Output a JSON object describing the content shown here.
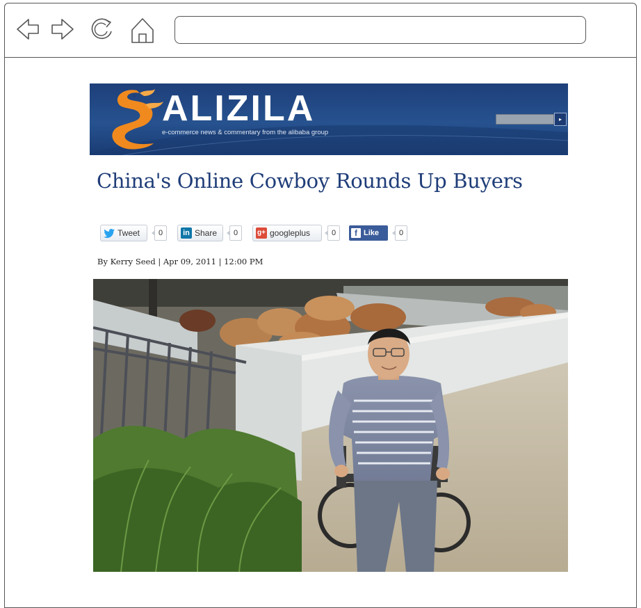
{
  "browser": {
    "address_value": "",
    "nav_icons": [
      "back-arrow-icon",
      "forward-arrow-icon",
      "reload-icon",
      "home-icon"
    ]
  },
  "site": {
    "logo_text": "ALIZILA",
    "tagline": "e-commerce news & commentary from the alibaba group",
    "search_go_glyph": "▸",
    "colors": {
      "banner": "#26528f",
      "logo_accent": "#f08a1e",
      "headline": "#1f3d78"
    }
  },
  "article": {
    "title": "China's Online Cowboy Rounds Up Buyers",
    "byline": "By Kerry Seed | Apr 09, 2011 | 12:00 PM"
  },
  "share": {
    "tweet_label": "Tweet",
    "tweet_count": "0",
    "linkedin_label": "Share",
    "linkedin_count": "0",
    "googleplus_label": "googleplus",
    "googleplus_count": "0",
    "facebook_label": "Like",
    "facebook_count": "0"
  },
  "photo": {
    "icon": "photo-cowboy-wheelchair-cattle-pen"
  }
}
